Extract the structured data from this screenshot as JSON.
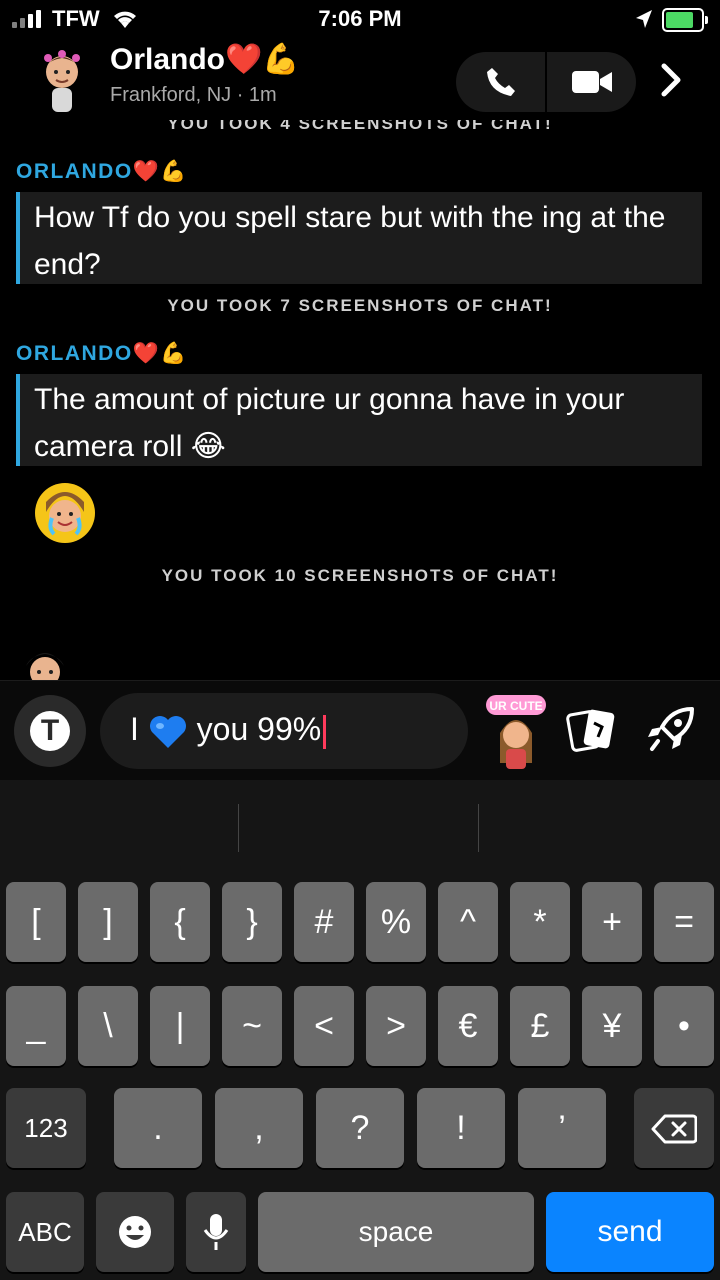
{
  "status_bar": {
    "carrier": "TFW",
    "time": "7:06 PM"
  },
  "header": {
    "name": "Orlando❤️💪",
    "location": "Frankford, NJ · 1m"
  },
  "chat": {
    "top_note": "YOU TOOK 4 SCREENSHOTS OF CHAT!",
    "messages": [
      {
        "sender": "ORLANDO❤️💪",
        "text": "How Tf do you spell stare but with the ing at the end?",
        "after_note": "YOU TOOK 7 SCREENSHOTS OF CHAT!"
      },
      {
        "sender": "ORLANDO❤️💪",
        "text": "The amount of picture ur gonna have in your camera roll 😂",
        "after_note": "YOU TOOK 10 SCREENSHOTS OF CHAT!"
      }
    ]
  },
  "composer": {
    "text_before": "I",
    "text_after": "you 99%",
    "sticker_text": "UR CUTE",
    "t_label": "T"
  },
  "keyboard": {
    "row1": [
      "[",
      "]",
      "{",
      "}",
      "#",
      "%",
      "^",
      "*",
      "+",
      "="
    ],
    "row2": [
      "_",
      "\\",
      "|",
      "~",
      "<",
      ">",
      "€",
      "£",
      "¥",
      "•"
    ],
    "row3": {
      "mode": "123",
      "keys": [
        ".",
        ",",
        "?",
        "!",
        "’"
      ]
    },
    "row4": {
      "abc": "ABC",
      "space": "space",
      "send": "send"
    }
  },
  "colors": {
    "accent": "#2fa7e0",
    "send": "#0a84ff",
    "caret": "#ff3b5c"
  }
}
